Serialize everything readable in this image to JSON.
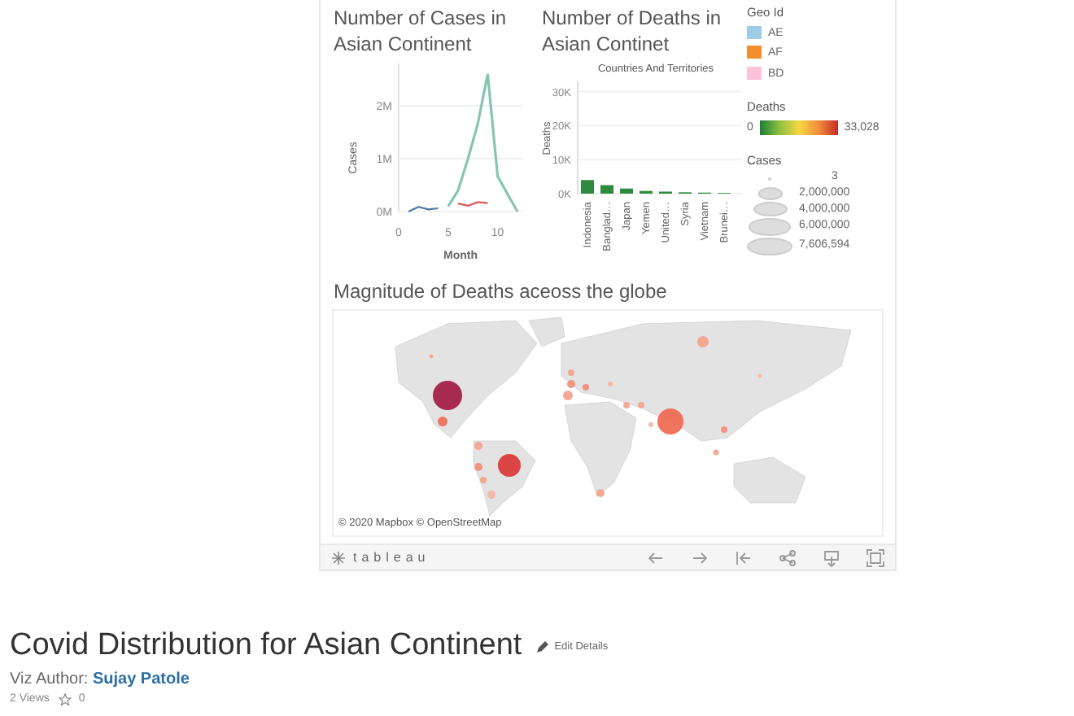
{
  "dashboard": {
    "cases_chart": {
      "title": "Number of Cases in Asian Continent",
      "chart_data": {
        "type": "line",
        "xlabel": "Month",
        "ylabel": "Cases",
        "x": [
          1,
          2,
          3,
          4,
          5,
          6,
          7,
          8,
          9,
          10,
          11,
          12
        ],
        "xlim": [
          0,
          12.5
        ],
        "ylim": [
          0,
          2800000
        ],
        "grid": true,
        "xticks": [
          0,
          5,
          10
        ],
        "yticks": [
          {
            "value": 0,
            "label": "0M"
          },
          {
            "value": 1000000,
            "label": "1M"
          },
          {
            "value": 2000000,
            "label": "2M"
          }
        ],
        "series": [
          {
            "color": "#86c5b4",
            "values": [
              null,
              null,
              null,
              null,
              100000,
              400000,
              1000000,
              1660000,
              2600000,
              670000,
              330000,
              0
            ]
          },
          {
            "color": "#4e79a7",
            "values": [
              0,
              90000,
              40000,
              60000,
              null,
              null,
              null,
              null,
              null,
              null,
              null,
              null
            ]
          },
          {
            "color": "#e15759",
            "values": [
              null,
              null,
              null,
              null,
              null,
              150000,
              110000,
              180000,
              160000,
              null,
              null,
              null
            ]
          }
        ]
      }
    },
    "deaths_chart": {
      "title": "Number of Deaths in Asian Continet",
      "chart_data": {
        "type": "bar",
        "xlabel": "Countries And Territories",
        "ylabel": "Deaths",
        "categories": [
          "Indonesia",
          "Banglad…",
          "Japan",
          "Yemen",
          "United…",
          "Syria",
          "Vietnam",
          "Brunei…"
        ],
        "values": [
          4000,
          2500,
          1500,
          800,
          600,
          400,
          300,
          200
        ],
        "ylim": [
          0,
          33000
        ],
        "grid": true,
        "yticks": [
          {
            "value": 0,
            "label": "0K"
          },
          {
            "value": 10000,
            "label": "10K"
          },
          {
            "value": 20000,
            "label": "20K"
          },
          {
            "value": 30000,
            "label": "30K"
          }
        ]
      }
    },
    "geo_legend": {
      "title": "Geo Id",
      "items": [
        {
          "label": "AE",
          "color": "#a0cbe8"
        },
        {
          "label": "AF",
          "color": "#f28e2b"
        },
        {
          "label": "BD",
          "color": "#ffc0d9"
        }
      ]
    },
    "deaths_legend": {
      "title": "Deaths",
      "min": "0",
      "max": "33,028"
    },
    "cases_legend": {
      "title": "Cases",
      "items": [
        "3",
        "2,000,000",
        "4,000,000",
        "6,000,000",
        "7,606,594"
      ]
    },
    "map": {
      "title": "Magnitude of Deaths aceoss the globe",
      "attribution": "© 2020 Mapbox © OpenStreetMap"
    },
    "toolbar": {
      "logo": "tableau"
    }
  },
  "footer": {
    "title": "Covid Distribution for Asian Continent",
    "edit": "Edit Details",
    "author_label": "Viz Author:",
    "author": "Sujay Patole",
    "views": "2 Views",
    "favorites": "0"
  }
}
